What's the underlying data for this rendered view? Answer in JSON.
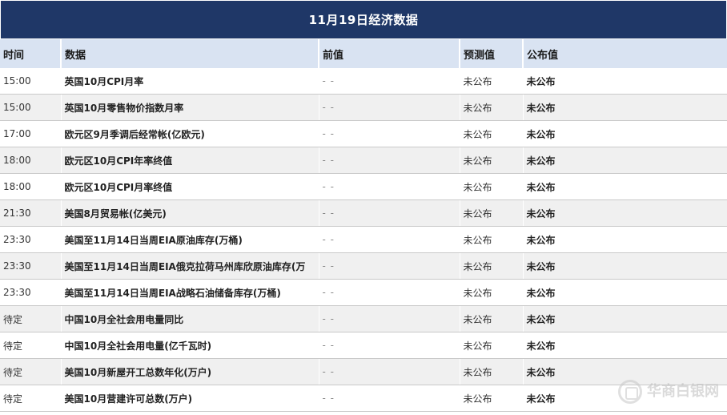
{
  "title": "11月19日经济数据",
  "columns": {
    "time": "时间",
    "data": "数据",
    "prev": "前值",
    "forecast": "预测值",
    "published": "公布值"
  },
  "rows": [
    {
      "time": "15:00",
      "name": "英国10月CPI月率",
      "prev": "- -",
      "forecast": "未公布",
      "published": "未公布"
    },
    {
      "time": "15:00",
      "name": "英国10月零售物价指数月率",
      "prev": "- -",
      "forecast": "未公布",
      "published": "未公布"
    },
    {
      "time": "17:00",
      "name": "欧元区9月季调后经常帐(亿欧元)",
      "prev": "- -",
      "forecast": "未公布",
      "published": "未公布"
    },
    {
      "time": "18:00",
      "name": "欧元区10月CPI年率终值",
      "prev": "- -",
      "forecast": "未公布",
      "published": "未公布"
    },
    {
      "time": "18:00",
      "name": "欧元区10月CPI月率终值",
      "prev": "- -",
      "forecast": "未公布",
      "published": "未公布"
    },
    {
      "time": "21:30",
      "name": "美国8月贸易帐(亿美元)",
      "prev": "- -",
      "forecast": "未公布",
      "published": "未公布"
    },
    {
      "time": "23:30",
      "name": "美国至11月14日当周EIA原油库存(万桶)",
      "prev": "- -",
      "forecast": "未公布",
      "published": "未公布"
    },
    {
      "time": "23:30",
      "name": "美国至11月14日当周EIA俄克拉荷马州库欣原油库存(万",
      "prev": "- -",
      "forecast": "未公布",
      "published": "未公布"
    },
    {
      "time": "23:30",
      "name": "美国至11月14日当周EIA战略石油储备库存(万桶)",
      "prev": "- -",
      "forecast": "未公布",
      "published": "未公布"
    },
    {
      "time": "待定",
      "name": "中国10月全社会用电量同比",
      "prev": "- -",
      "forecast": "未公布",
      "published": "未公布"
    },
    {
      "time": "待定",
      "name": "中国10月全社会用电量(亿千瓦时)",
      "prev": "- -",
      "forecast": "未公布",
      "published": "未公布"
    },
    {
      "time": "待定",
      "name": "美国10月新屋开工总数年化(万户)",
      "prev": "- -",
      "forecast": "未公布",
      "published": "未公布"
    },
    {
      "time": "待定",
      "name": "美国10月营建许可总数(万户)",
      "prev": "- -",
      "forecast": "未公布",
      "published": "未公布"
    }
  ],
  "colors": {
    "title_bg": "#1f3767",
    "header_bg": "#d9e3f2",
    "row_alt_bg": "#f0f0f0"
  },
  "watermark": {
    "icon": "brand-logo-icon",
    "text": "华商白银网"
  }
}
